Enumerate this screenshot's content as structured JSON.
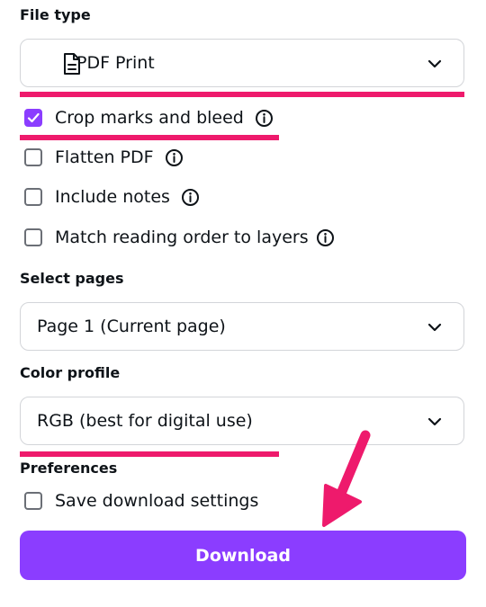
{
  "file_type": {
    "label": "File type",
    "selected": "PDF Print",
    "icon": "document-icon"
  },
  "options": [
    {
      "label": "Crop marks and bleed",
      "checked": true
    },
    {
      "label": "Flatten PDF",
      "checked": false
    },
    {
      "label": "Include notes",
      "checked": false
    },
    {
      "label": "Match reading order to layers",
      "checked": false
    }
  ],
  "select_pages": {
    "label": "Select pages",
    "selected": "Page 1 (Current page)"
  },
  "color_profile": {
    "label": "Color profile",
    "selected": "RGB (best for digital use)"
  },
  "preferences": {
    "label": "Preferences",
    "option": {
      "label": "Save download settings",
      "checked": false
    }
  },
  "download_button": {
    "label": "Download"
  },
  "colors": {
    "accent": "#8b3dff",
    "highlight": "#ee1a6c"
  }
}
